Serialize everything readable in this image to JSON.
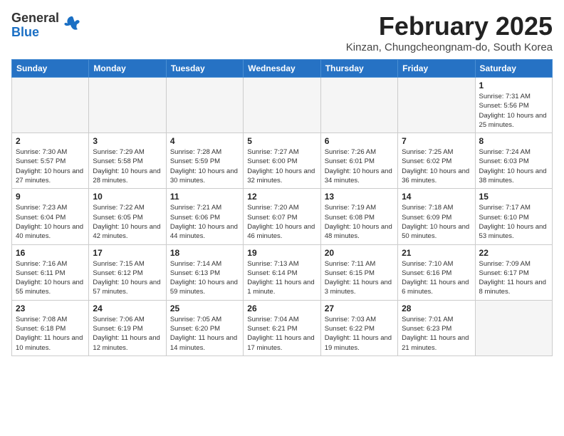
{
  "header": {
    "logo_general": "General",
    "logo_blue": "Blue",
    "month_year": "February 2025",
    "location": "Kinzan, Chungcheongnam-do, South Korea"
  },
  "days_of_week": [
    "Sunday",
    "Monday",
    "Tuesday",
    "Wednesday",
    "Thursday",
    "Friday",
    "Saturday"
  ],
  "weeks": [
    [
      {
        "day": "",
        "empty": true
      },
      {
        "day": "",
        "empty": true
      },
      {
        "day": "",
        "empty": true
      },
      {
        "day": "",
        "empty": true
      },
      {
        "day": "",
        "empty": true
      },
      {
        "day": "",
        "empty": true
      },
      {
        "day": "1",
        "sunrise": "7:31 AM",
        "sunset": "5:56 PM",
        "daylight": "10 hours and 25 minutes."
      }
    ],
    [
      {
        "day": "2",
        "sunrise": "7:30 AM",
        "sunset": "5:57 PM",
        "daylight": "10 hours and 27 minutes."
      },
      {
        "day": "3",
        "sunrise": "7:29 AM",
        "sunset": "5:58 PM",
        "daylight": "10 hours and 28 minutes."
      },
      {
        "day": "4",
        "sunrise": "7:28 AM",
        "sunset": "5:59 PM",
        "daylight": "10 hours and 30 minutes."
      },
      {
        "day": "5",
        "sunrise": "7:27 AM",
        "sunset": "6:00 PM",
        "daylight": "10 hours and 32 minutes."
      },
      {
        "day": "6",
        "sunrise": "7:26 AM",
        "sunset": "6:01 PM",
        "daylight": "10 hours and 34 minutes."
      },
      {
        "day": "7",
        "sunrise": "7:25 AM",
        "sunset": "6:02 PM",
        "daylight": "10 hours and 36 minutes."
      },
      {
        "day": "8",
        "sunrise": "7:24 AM",
        "sunset": "6:03 PM",
        "daylight": "10 hours and 38 minutes."
      }
    ],
    [
      {
        "day": "9",
        "sunrise": "7:23 AM",
        "sunset": "6:04 PM",
        "daylight": "10 hours and 40 minutes."
      },
      {
        "day": "10",
        "sunrise": "7:22 AM",
        "sunset": "6:05 PM",
        "daylight": "10 hours and 42 minutes."
      },
      {
        "day": "11",
        "sunrise": "7:21 AM",
        "sunset": "6:06 PM",
        "daylight": "10 hours and 44 minutes."
      },
      {
        "day": "12",
        "sunrise": "7:20 AM",
        "sunset": "6:07 PM",
        "daylight": "10 hours and 46 minutes."
      },
      {
        "day": "13",
        "sunrise": "7:19 AM",
        "sunset": "6:08 PM",
        "daylight": "10 hours and 48 minutes."
      },
      {
        "day": "14",
        "sunrise": "7:18 AM",
        "sunset": "6:09 PM",
        "daylight": "10 hours and 50 minutes."
      },
      {
        "day": "15",
        "sunrise": "7:17 AM",
        "sunset": "6:10 PM",
        "daylight": "10 hours and 53 minutes."
      }
    ],
    [
      {
        "day": "16",
        "sunrise": "7:16 AM",
        "sunset": "6:11 PM",
        "daylight": "10 hours and 55 minutes."
      },
      {
        "day": "17",
        "sunrise": "7:15 AM",
        "sunset": "6:12 PM",
        "daylight": "10 hours and 57 minutes."
      },
      {
        "day": "18",
        "sunrise": "7:14 AM",
        "sunset": "6:13 PM",
        "daylight": "10 hours and 59 minutes."
      },
      {
        "day": "19",
        "sunrise": "7:13 AM",
        "sunset": "6:14 PM",
        "daylight": "11 hours and 1 minute."
      },
      {
        "day": "20",
        "sunrise": "7:11 AM",
        "sunset": "6:15 PM",
        "daylight": "11 hours and 3 minutes."
      },
      {
        "day": "21",
        "sunrise": "7:10 AM",
        "sunset": "6:16 PM",
        "daylight": "11 hours and 6 minutes."
      },
      {
        "day": "22",
        "sunrise": "7:09 AM",
        "sunset": "6:17 PM",
        "daylight": "11 hours and 8 minutes."
      }
    ],
    [
      {
        "day": "23",
        "sunrise": "7:08 AM",
        "sunset": "6:18 PM",
        "daylight": "11 hours and 10 minutes."
      },
      {
        "day": "24",
        "sunrise": "7:06 AM",
        "sunset": "6:19 PM",
        "daylight": "11 hours and 12 minutes."
      },
      {
        "day": "25",
        "sunrise": "7:05 AM",
        "sunset": "6:20 PM",
        "daylight": "11 hours and 14 minutes."
      },
      {
        "day": "26",
        "sunrise": "7:04 AM",
        "sunset": "6:21 PM",
        "daylight": "11 hours and 17 minutes."
      },
      {
        "day": "27",
        "sunrise": "7:03 AM",
        "sunset": "6:22 PM",
        "daylight": "11 hours and 19 minutes."
      },
      {
        "day": "28",
        "sunrise": "7:01 AM",
        "sunset": "6:23 PM",
        "daylight": "11 hours and 21 minutes."
      },
      {
        "day": "",
        "empty": true
      }
    ]
  ]
}
